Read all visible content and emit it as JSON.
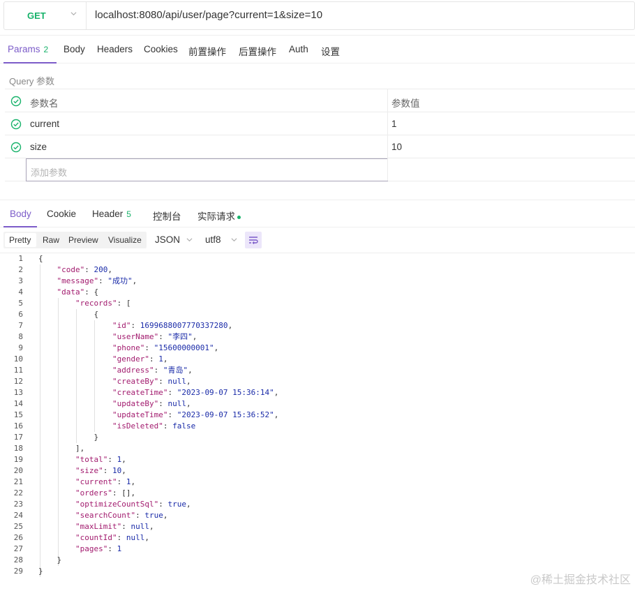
{
  "request": {
    "method": "GET",
    "url": "localhost:8080/api/user/page?current=1&size=10"
  },
  "request_tabs": [
    {
      "label": "Params",
      "count": "2"
    },
    {
      "label": "Body"
    },
    {
      "label": "Headers"
    },
    {
      "label": "Cookies"
    },
    {
      "label": "前置操作"
    },
    {
      "label": "后置操作"
    },
    {
      "label": "Auth"
    },
    {
      "label": "设置"
    }
  ],
  "query": {
    "title": "Query 参数",
    "header": {
      "name": "参数名",
      "value": "参数值"
    },
    "params": [
      {
        "name": "current",
        "value": "1"
      },
      {
        "name": "size",
        "value": "10"
      }
    ],
    "add_placeholder": "添加参数"
  },
  "response_tabs": [
    {
      "label": "Body"
    },
    {
      "label": "Cookie"
    },
    {
      "label": "Header",
      "count": "5"
    },
    {
      "label": "控制台"
    },
    {
      "label": "实际请求"
    }
  ],
  "format": {
    "modes": [
      "Pretty",
      "Raw",
      "Preview",
      "Visualize"
    ],
    "type": "JSON",
    "encoding": "utf8"
  },
  "code_lines": [
    "{",
    "    \"code\": 200,",
    "    \"message\": \"成功\",",
    "    \"data\": {",
    "        \"records\": [",
    "            {",
    "                \"id\": 1699688007770337280,",
    "                \"userName\": \"李四\",",
    "                \"phone\": \"15600000001\",",
    "                \"gender\": 1,",
    "                \"address\": \"青岛\",",
    "                \"createBy\": null,",
    "                \"createTime\": \"2023-09-07 15:36:14\",",
    "                \"updateBy\": null,",
    "                \"updateTime\": \"2023-09-07 15:36:52\",",
    "                \"isDeleted\": false",
    "            }",
    "        ],",
    "        \"total\": 1,",
    "        \"size\": 10,",
    "        \"current\": 1,",
    "        \"orders\": [],",
    "        \"optimizeCountSql\": true,",
    "        \"searchCount\": true,",
    "        \"maxLimit\": null,",
    "        \"countId\": null,",
    "        \"pages\": 1",
    "    }",
    "}"
  ],
  "watermark": "@稀土掘金技术社区",
  "colors": {
    "accent": "#7c5cc9",
    "success": "#17b26a",
    "json_key": "#a21b6e",
    "json_value": "#1a2ba8"
  }
}
